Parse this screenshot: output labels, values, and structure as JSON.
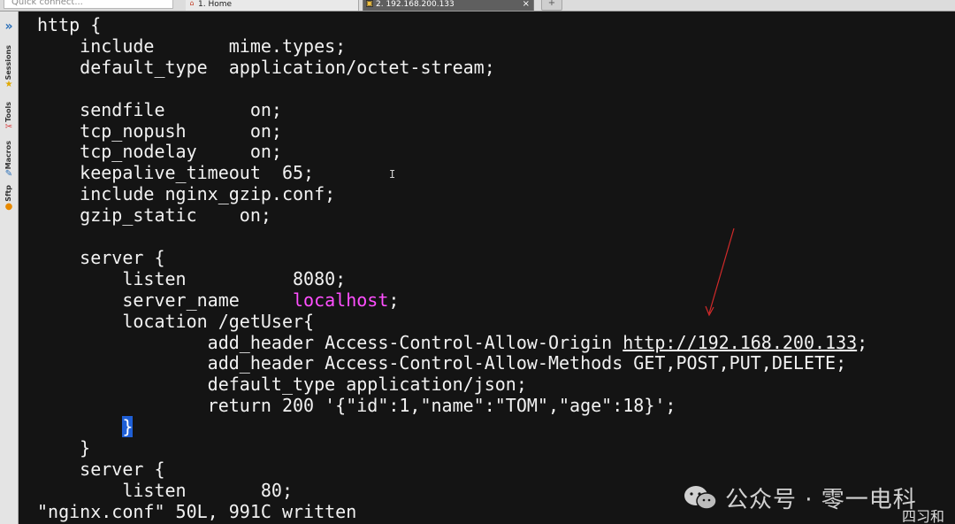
{
  "window": {
    "quick_connect_placeholder": "Quick connect...",
    "tabs": [
      {
        "label": "1. Home",
        "icon": "home-icon"
      },
      {
        "label": "2. 192.168.200.133",
        "icon": "terminal-icon",
        "close": "×"
      }
    ],
    "new_tab_symbol": "+"
  },
  "sidebar": {
    "expand_symbol": "»",
    "items": [
      {
        "label": "Sessions",
        "icon": "star-icon"
      },
      {
        "label": "Tools",
        "icon": "tools-icon"
      },
      {
        "label": "Macros",
        "icon": "macro-icon"
      },
      {
        "label": "Sftp",
        "icon": "sftp-icon"
      }
    ]
  },
  "terminal": {
    "lines": [
      {
        "text": "http {"
      },
      {
        "text": "    include       mime.types;"
      },
      {
        "text": "    default_type  application/octet-stream;"
      },
      {
        "text": ""
      },
      {
        "text": "    sendfile        on;"
      },
      {
        "text": "    tcp_nopush      on;"
      },
      {
        "text": "    tcp_nodelay     on;"
      },
      {
        "text": "    keepalive_timeout  65;"
      },
      {
        "text": "    include nginx_gzip.conf;"
      },
      {
        "text": "    gzip_static    on;"
      },
      {
        "text": ""
      },
      {
        "text": "    server {"
      },
      {
        "text": "        listen          8080;"
      },
      {
        "prefix": "        server_name     ",
        "highlight": "localhost",
        "suffix": ";"
      },
      {
        "text": "        location /getUser{"
      },
      {
        "prefix": "                add_header Access-Control-Allow-Origin ",
        "link": "http://192.168.200.133",
        "suffix": ";"
      },
      {
        "text": "                add_header Access-Control-Allow-Methods GET,POST,PUT,DELETE;"
      },
      {
        "text": "                default_type application/json;"
      },
      {
        "text": "                return 200 '{\"id\":1,\"name\":\"TOM\",\"age\":18}';"
      },
      {
        "prefix": "        ",
        "cursor": "}"
      },
      {
        "text": "    }"
      },
      {
        "text": "    server {"
      },
      {
        "text": "        listen       80;"
      },
      {
        "text": "\"nginx.conf\" 50L, 991C written"
      }
    ]
  },
  "watermark": {
    "text": "公众号 · 零一电科",
    "icon": "wechat-icon"
  },
  "corner_fragment": {
    "text": "四习和"
  },
  "colors": {
    "terminal_bg": "#141414",
    "terminal_fg": "#f2f2f2",
    "highlight_magenta": "#ff4fff",
    "cursor_blue": "#1f5fd6",
    "annotation_red": "#d22a2a"
  }
}
